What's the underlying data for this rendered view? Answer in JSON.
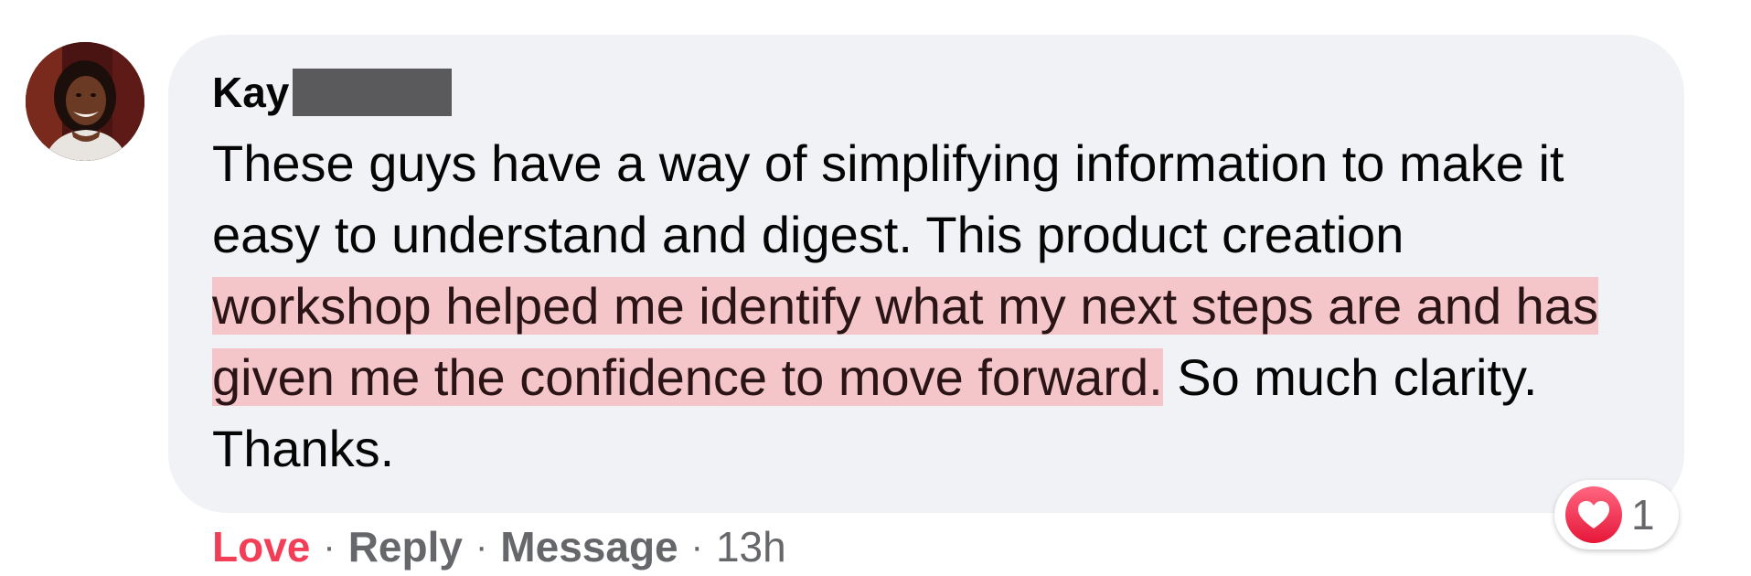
{
  "comment": {
    "author_first_name": "Kay",
    "text_before_highlight": "These guys have a way of simplifying information to make it easy to understand and digest. This product creation ",
    "text_highlighted": "workshop helped me identify what my next steps are and has given me the confidence to move forward.",
    "text_after_highlight": " So much clarity. Thanks.",
    "bubble_color": "#f0f2f5",
    "highlight_color": "#f4c6c9"
  },
  "reaction": {
    "icon": "heart-icon",
    "count": "1",
    "color": "#f33e58"
  },
  "actions": {
    "love_label": "Love",
    "separator": "·",
    "reply_label": "Reply",
    "message_label": "Message",
    "timestamp": "13h"
  }
}
